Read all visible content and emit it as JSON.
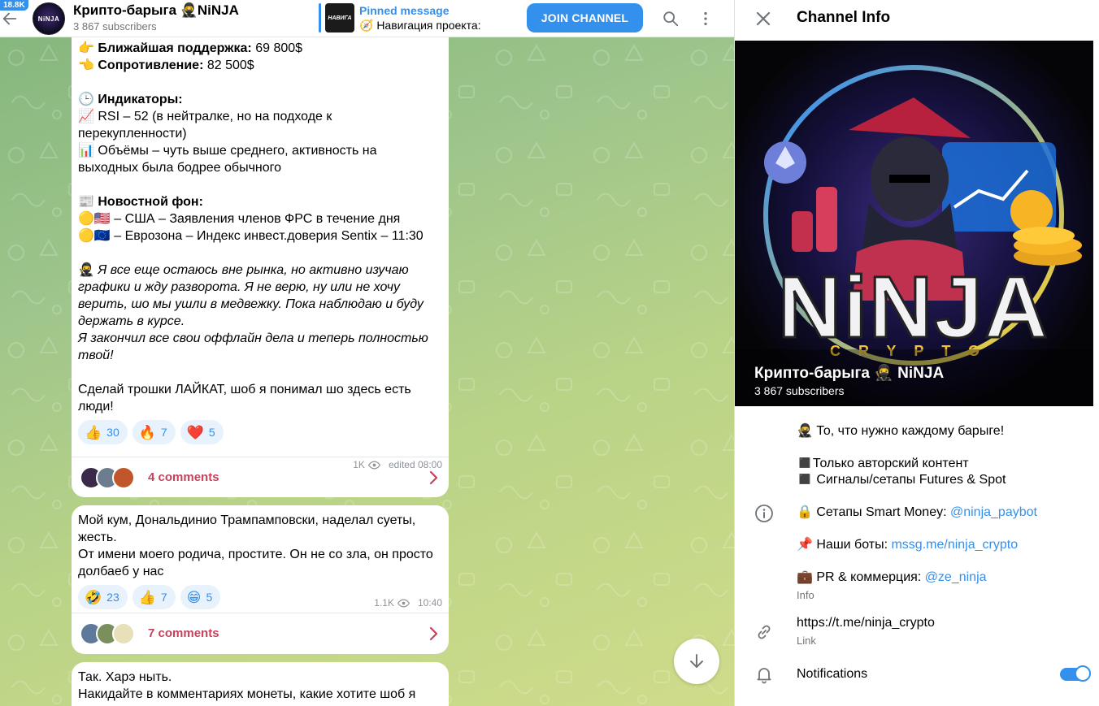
{
  "header": {
    "badge": "18.8K",
    "title": "Крипто-барыга 🥷NiNJA",
    "subscribers": "3 867 subscribers",
    "avatar_text": "NiNJA",
    "pinned_thumb_text": "НАВИГА",
    "pinned_title": "Pinned message",
    "pinned_text": "🧭 Навигация проекта:",
    "join_label": "JOIN CHANNEL"
  },
  "messages": [
    {
      "lines": [
        {
          "style": "",
          "parts": [
            {
              "t": "👉 "
            },
            {
              "t": "Ближайшая поддержка:",
              "b": true
            },
            {
              "t": " 69 800$"
            }
          ]
        },
        {
          "style": "",
          "parts": [
            {
              "t": "👈 "
            },
            {
              "t": "Сопротивление:",
              "b": true
            },
            {
              "t": " 82 500$"
            }
          ]
        },
        {
          "style": "blank"
        },
        {
          "style": "",
          "parts": [
            {
              "t": "🕒 "
            },
            {
              "t": "Индикаторы:",
              "b": true
            }
          ]
        },
        {
          "style": "",
          "parts": [
            {
              "t": "📈 RSI – 52 (в нейтралке, но на подходе к"
            }
          ]
        },
        {
          "style": "",
          "parts": [
            {
              "t": "перекупленности)"
            }
          ]
        },
        {
          "style": "",
          "parts": [
            {
              "t": "📊 Объёмы – чуть выше среднего, активность на"
            }
          ]
        },
        {
          "style": "",
          "parts": [
            {
              "t": "выходных была бодрее обычного"
            }
          ]
        },
        {
          "style": "blank"
        },
        {
          "style": "",
          "parts": [
            {
              "t": "📰 "
            },
            {
              "t": "Новостной фон:",
              "b": true
            }
          ]
        },
        {
          "style": "",
          "parts": [
            {
              "t": "🟡🇺🇸 – США – Заявления членов ФРС в течение дня"
            }
          ]
        },
        {
          "style": "",
          "parts": [
            {
              "t": "🟡🇪🇺 – Еврозона – Индекс инвест.доверия Sentix – 11:30"
            }
          ]
        },
        {
          "style": "blank"
        },
        {
          "style": "",
          "parts": [
            {
              "t": "🥷 "
            },
            {
              "t": "Я все еще остаюсь вне рынка, но активно изучаю",
              "i": true
            }
          ]
        },
        {
          "style": "",
          "parts": [
            {
              "t": "графики и жду разворота. Я не верю, ну или не хочу",
              "i": true
            }
          ]
        },
        {
          "style": "",
          "parts": [
            {
              "t": "верить, шо мы ушли в медвежку. Пока наблюдаю и буду",
              "i": true
            }
          ]
        },
        {
          "style": "",
          "parts": [
            {
              "t": "держать в курсе.",
              "i": true
            }
          ]
        },
        {
          "style": "",
          "parts": [
            {
              "t": "Я закончил все свои оффлайн дела и теперь полностью",
              "i": true
            }
          ]
        },
        {
          "style": "",
          "parts": [
            {
              "t": "твой!",
              "i": true
            }
          ]
        },
        {
          "style": "blank"
        },
        {
          "style": "",
          "parts": [
            {
              "t": "Сделай трошки ЛАЙКАТ, шоб я понимал шо здесь есть"
            }
          ]
        },
        {
          "style": "",
          "parts": [
            {
              "t": "люди!"
            }
          ]
        }
      ],
      "reactions": [
        {
          "emoji": "👍",
          "count": "30"
        },
        {
          "emoji": "🔥",
          "count": "7"
        },
        {
          "emoji": "❤️",
          "count": "5"
        }
      ],
      "views": "1K",
      "time": "edited 08:00",
      "comments": "4 comments"
    },
    {
      "lines": [
        {
          "style": "",
          "parts": [
            {
              "t": "Мой кум, Дональдинио Трампамповски, наделал суеты,"
            }
          ]
        },
        {
          "style": "",
          "parts": [
            {
              "t": "жесть."
            }
          ]
        },
        {
          "style": "",
          "parts": [
            {
              "t": "От имени моего родича, простите. Он не со зла, он просто"
            }
          ]
        },
        {
          "style": "",
          "parts": [
            {
              "t": "долбаеб у нас"
            }
          ]
        }
      ],
      "reactions": [
        {
          "emoji": "🤣",
          "count": "23"
        },
        {
          "emoji": "👍",
          "count": "7"
        },
        {
          "emoji": "😁",
          "count": "5"
        }
      ],
      "views": "1.1K",
      "time": "10:40",
      "comments": "7 comments"
    },
    {
      "lines": [
        {
          "style": "",
          "parts": [
            {
              "t": "Так. Харэ ныть."
            }
          ]
        },
        {
          "style": "",
          "parts": [
            {
              "t": "Накидайте в комментариях монеты, какие хотите шоб я"
            }
          ]
        }
      ]
    }
  ],
  "panel": {
    "title": "Channel Info",
    "cover_name": "Крипто-барыга 🥷 NiNJA",
    "cover_subscribers": "3 867 subscribers",
    "cover_logo_main": "NiNJA",
    "cover_logo_sub": "CRYPTO",
    "about": {
      "line1": "🥷 То, что нужно каждому барыге!",
      "line2": "◼️Только авторский контент",
      "line3": "◼️ Сигналы/сетапы Futures & Spot",
      "line4_prefix": "🔒 Сетапы Smart Money: ",
      "line4_link": "@ninja_paybot",
      "line5_prefix": "📌 Наши боты: ",
      "line5_link": "mssg.me/ninja_crypto",
      "line6_prefix": "💼 PR & коммерция: ",
      "line6_link": "@ze_ninja",
      "label": "Info"
    },
    "link": {
      "value": "https://t.me/ninja_crypto",
      "label": "Link"
    },
    "notifications": {
      "label": "Notifications",
      "enabled": true
    }
  },
  "colors": {
    "accent": "#3390ec",
    "comments": "#c8415b",
    "muted": "#707579"
  }
}
